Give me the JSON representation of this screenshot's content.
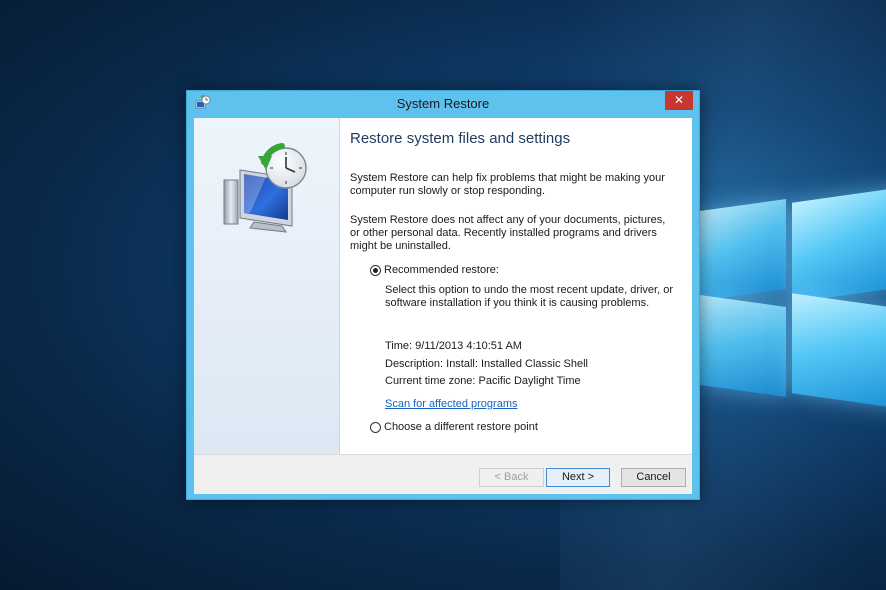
{
  "dialog": {
    "title": "System Restore",
    "close_glyph": "✕",
    "heading": "Restore system files and settings",
    "intro_1": "System Restore can help fix problems that might be making your computer run slowly or stop responding.",
    "intro_2": "System Restore does not affect any of your documents, pictures, or other personal data. Recently installed programs and drivers might be uninstalled.",
    "options": {
      "recommended": {
        "label": "Recommended restore:",
        "selected": true,
        "description": "Select this option to undo the most recent update, driver, or software installation if you think it is causing problems."
      },
      "different": {
        "label": "Choose a different restore point",
        "selected": false
      }
    },
    "restore_point": {
      "time": "Time: 9/11/2013 4:10:51 AM",
      "description": "Description: Install: Installed Classic Shell",
      "timezone": "Current time zone: Pacific Daylight Time"
    },
    "scan_link": "Scan for affected programs",
    "buttons": {
      "back": "< Back",
      "next": "Next >",
      "cancel": "Cancel"
    }
  },
  "colors": {
    "titlebar": "#5ec1ee",
    "close": "#c7372f",
    "link": "#1565c0",
    "heading": "#1d3b5c"
  },
  "icons": {
    "title": "system-restore-icon",
    "main": "computer-restore-clock-icon",
    "close": "close-icon"
  }
}
